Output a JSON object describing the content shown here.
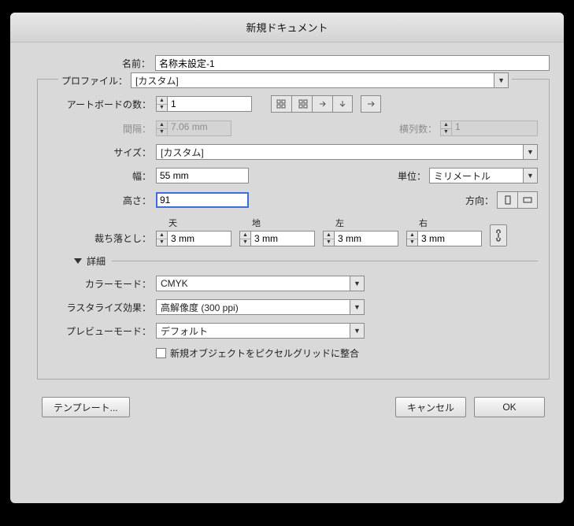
{
  "title": "新規ドキュメント",
  "name": {
    "label": "名前",
    "value": "名称未設定-1"
  },
  "profile": {
    "label": "プロファイル",
    "value": "[カスタム]"
  },
  "artboards": {
    "label": "アートボードの数",
    "value": "1"
  },
  "spacing": {
    "label": "間隔",
    "value": "7.06 mm"
  },
  "columns": {
    "label": "横列数",
    "value": "1"
  },
  "size": {
    "label": "サイズ",
    "value": "[カスタム]"
  },
  "width": {
    "label": "幅",
    "value": "55 mm"
  },
  "units": {
    "label": "単位",
    "value": "ミリメートル"
  },
  "height": {
    "label": "高さ",
    "value": "91"
  },
  "orientation": {
    "label": "方向"
  },
  "bleed": {
    "label": "裁ち落とし",
    "top_label": "天",
    "top": "3 mm",
    "bottom_label": "地",
    "bottom": "3 mm",
    "left_label": "左",
    "left": "3 mm",
    "right_label": "右",
    "right": "3 mm"
  },
  "advanced": {
    "label": "詳細"
  },
  "colorMode": {
    "label": "カラーモード",
    "value": "CMYK"
  },
  "raster": {
    "label": "ラスタライズ効果",
    "value": "高解像度 (300 ppi)"
  },
  "preview": {
    "label": "プレビューモード",
    "value": "デフォルト"
  },
  "alignPixelGrid": {
    "label": "新規オブジェクトをピクセルグリッドに整合",
    "checked": false
  },
  "buttons": {
    "template": "テンプレート...",
    "cancel": "キャンセル",
    "ok": "OK"
  }
}
